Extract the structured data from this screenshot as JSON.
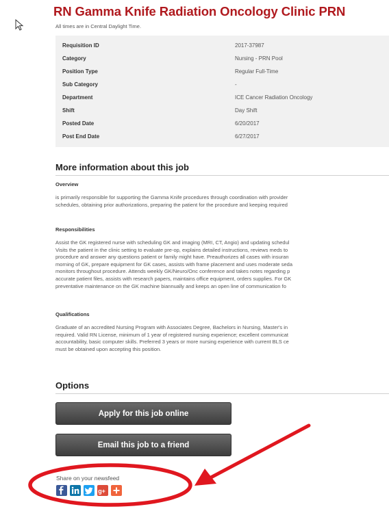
{
  "job": {
    "title": "RN Gamma Knife Radiation Oncology Clinic PRN",
    "timezone_note": "All times are in Central Daylight Time."
  },
  "details": [
    {
      "label": "Requisition ID",
      "value": "2017-37987"
    },
    {
      "label": "Category",
      "value": "Nursing - PRN Pool"
    },
    {
      "label": "Position Type",
      "value": "Regular Full-Time"
    },
    {
      "label": "Sub Category",
      "value": "-"
    },
    {
      "label": "Department",
      "value": "ICE Cancer Radiation Oncology"
    },
    {
      "label": "Shift",
      "value": "Day Shift"
    },
    {
      "label": "Posted Date",
      "value": "6/20/2017"
    },
    {
      "label": "Post End Date",
      "value": "6/27/2017"
    }
  ],
  "more_info": {
    "heading": "More information about this job",
    "overview_heading": "Overview",
    "overview_lines": [
      "is primarily responsible for supporting the Gamma Knife procedures through coordination with provider",
      "schedules, obtaining prior authorizations, preparing the patient for the procedure and keeping required"
    ],
    "responsibilities_heading": "Responsibilities",
    "responsibilities_lines": [
      "Assist the GK registered nurse with scheduling GK and imaging (MRI, CT, Angio) and updating schedul",
      "Visits the patient in the clinic setting to evaluate pre-op, explains detailed instructions, reviews meds to",
      "procedure and answer any questions patient or family might have. Preauthorizes all cases with insuran",
      "morning of GK, prepare equipment for GK cases, assists with frame placement and uses moderate seda",
      "monitors throughout procedure. Attends weekly GK/Neuro/Onc conference and takes notes regarding p",
      "accurate patient files, assists with research papers, maintains office equipment, orders supplies. For GK",
      "preventative maintenance on the GK machine biannually and keeps an open line of communication fo"
    ],
    "qualifications_heading": "Qualifications",
    "qualifications_lines": [
      "Graduate of an accredited Nursing Program with Associates Degree, Bachelors in Nursing, Master's in",
      "required. Valid RN License, minimum of 1 year of registered nursing experience; excellent communicat",
      "accountability, basic computer skills. Preferred 3 years or more nursing experience with current BLS ce",
      "must be obtained upon accepting this position."
    ]
  },
  "options": {
    "heading": "Options",
    "apply_label": "Apply for this job online",
    "email_label": "Email this job to a friend"
  },
  "share": {
    "label": "Share on your newsfeed",
    "networks": [
      {
        "name": "facebook-icon",
        "color": "#3b5998"
      },
      {
        "name": "linkedin-icon",
        "color": "#0e76a8"
      },
      {
        "name": "twitter-icon",
        "color": "#1da1f2"
      },
      {
        "name": "google-plus-icon",
        "color": "#dd4b39"
      },
      {
        "name": "addthis-plus-icon",
        "color": "#f0643c"
      }
    ]
  },
  "annotation": {
    "ellipse_color": "#e0171f",
    "arrow_color": "#e0171f"
  }
}
